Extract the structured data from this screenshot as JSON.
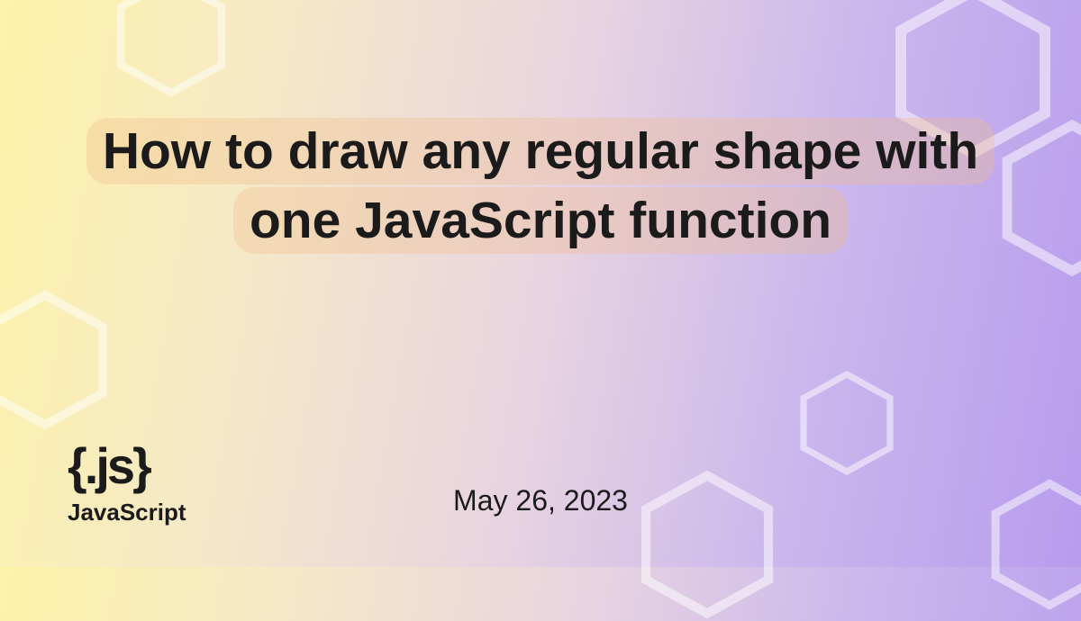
{
  "title": "How to draw any regular shape with one JavaScript function",
  "logo": {
    "icon_text": "{.js}",
    "label": "JavaScript"
  },
  "date": "May 26, 2023"
}
